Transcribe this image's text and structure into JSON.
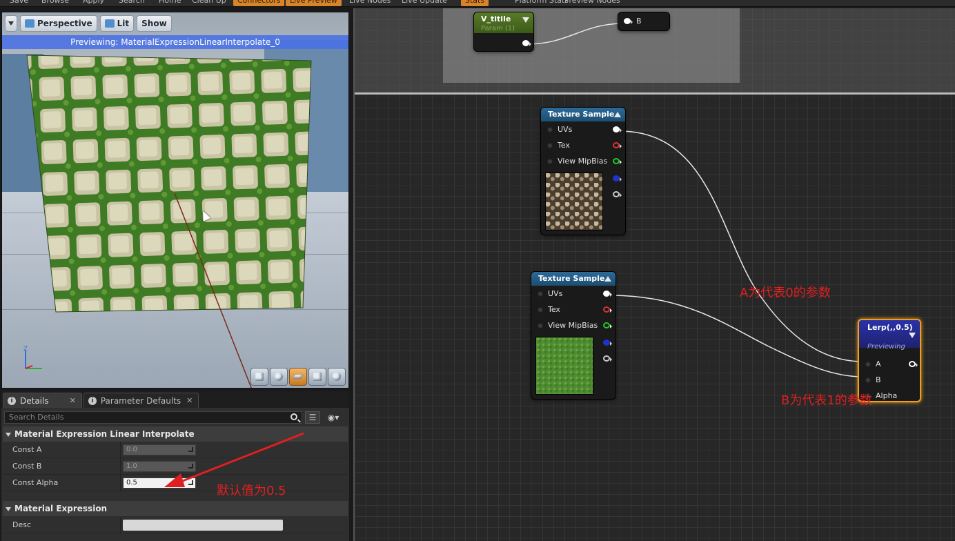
{
  "toolbar": {
    "items": [
      {
        "label": "Save",
        "highlight": false
      },
      {
        "label": "Browse",
        "highlight": false
      },
      {
        "label": "Apply",
        "highlight": false
      },
      {
        "label": "Search",
        "highlight": false
      },
      {
        "label": "Home",
        "highlight": false
      },
      {
        "label": "Clean Up",
        "highlight": false
      },
      {
        "label": "Connectors",
        "highlight": true
      },
      {
        "label": "Live Preview",
        "highlight": true
      },
      {
        "label": "Live Nodes",
        "highlight": false
      },
      {
        "label": "Live Update",
        "highlight": false
      },
      {
        "label": "Stats",
        "highlight": true
      },
      {
        "label": "Platform Stats",
        "highlight": false
      },
      {
        "label": "Preview Nodes",
        "highlight": false
      }
    ]
  },
  "viewport": {
    "perspective_label": "Perspective",
    "lit_label": "Lit",
    "show_label": "Show",
    "preview_banner": "Previewing: MaterialExpressionLinearInterpolate_0",
    "view_mode_icons": [
      "cylinder-icon",
      "sphere-icon",
      "plane-icon",
      "cube-icon",
      "teapot-icon"
    ],
    "active_view_index": 2
  },
  "details": {
    "tabs": [
      {
        "label": "Details",
        "active": true
      },
      {
        "label": "Parameter Defaults",
        "active": false
      }
    ],
    "search_placeholder": "Search Details",
    "sections": [
      {
        "title": "Material Expression Linear Interpolate",
        "properties": [
          {
            "label": "Const A",
            "value": "0.0"
          },
          {
            "label": "Const B",
            "value": "1.0"
          },
          {
            "label": "Const Alpha",
            "value": "0.5"
          }
        ]
      },
      {
        "title": "Material Expression",
        "properties": [
          {
            "label": "Desc",
            "value": ""
          }
        ]
      }
    ]
  },
  "graph": {
    "param_node": {
      "title": "V_titile",
      "subtitle": "Param (1)"
    },
    "b_node": {
      "label": "B"
    },
    "texture_nodes": [
      {
        "title": "Texture Sample",
        "pins": [
          "UVs",
          "Tex",
          "View MipBias"
        ],
        "texture": "stone"
      },
      {
        "title": "Texture Sample",
        "pins": [
          "UVs",
          "Tex",
          "View MipBias"
        ],
        "texture": "grass"
      }
    ],
    "lerp_node": {
      "title": "Lerp(,,0.5)",
      "subtitle": "Previewing",
      "pins": [
        "A",
        "B",
        "Alpha"
      ]
    }
  },
  "annotations": {
    "a_note": "A为代表0的参数",
    "b_note": "B为代表1的参数",
    "default_note": "默认值为0.5",
    "color": "#e02020"
  },
  "colors": {
    "lerp_border": "#f0a020",
    "texture_header": "#2c6a97",
    "param_header": "#5a7a2a",
    "preview_banner": "#466ee6"
  }
}
